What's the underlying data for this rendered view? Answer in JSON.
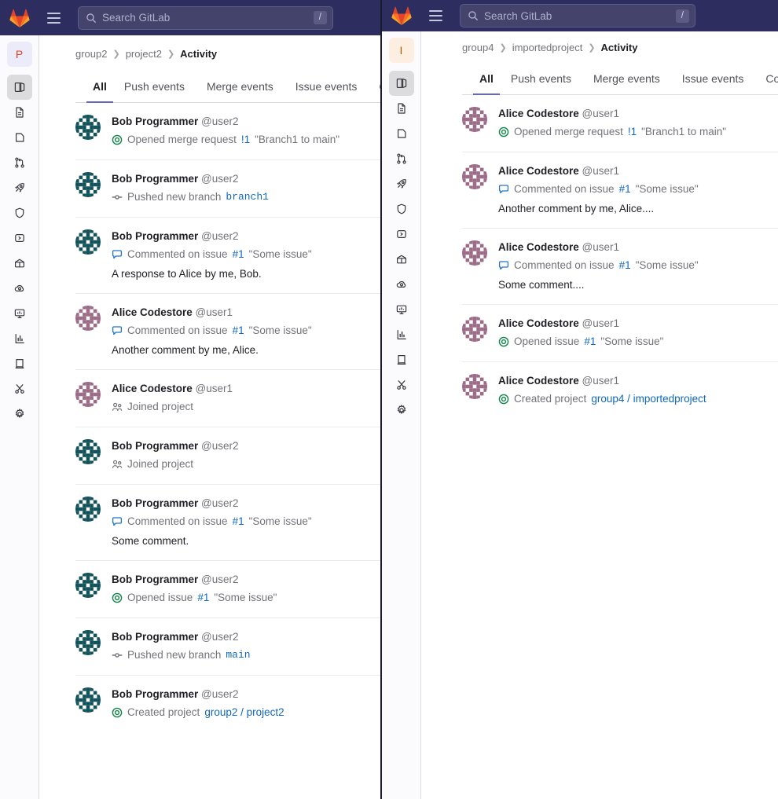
{
  "colors": {
    "header_bg": "#2d2d60",
    "accent": "#6666c4",
    "link": "#1068bf",
    "green": "#108548",
    "avatar_bob": "#12525a",
    "avatar_alice": "#9b6b87",
    "project_avatar_p_bg": "#ecebfa",
    "project_avatar_p_fg": "#e24329",
    "project_avatar_i_bg": "#fdeee2",
    "project_avatar_i_fg": "#ab6100"
  },
  "search": {
    "placeholder": "Search GitLab",
    "shortcut": "/"
  },
  "rail_icons": [
    {
      "name": "project-overview-icon",
      "active": true
    },
    {
      "name": "repository-file-icon",
      "active": false
    },
    {
      "name": "issues-icon",
      "active": false
    },
    {
      "name": "merge-requests-icon",
      "active": false
    },
    {
      "name": "pipelines-rocket-icon",
      "active": false
    },
    {
      "name": "security-shield-icon",
      "active": false
    },
    {
      "name": "deployments-icon",
      "active": false
    },
    {
      "name": "packages-box-icon",
      "active": false
    },
    {
      "name": "operations-cloud-gear-icon",
      "active": false
    },
    {
      "name": "monitor-icon",
      "active": false
    },
    {
      "name": "analytics-chart-icon",
      "active": false
    },
    {
      "name": "wiki-book-icon",
      "active": false
    },
    {
      "name": "snippets-scissors-icon",
      "active": false
    },
    {
      "name": "settings-gear-icon",
      "active": false
    }
  ],
  "tabs": [
    "All",
    "Push events",
    "Merge events",
    "Issue events",
    "Comments"
  ],
  "window_back": {
    "project_initial": "P",
    "breadcrumb": {
      "group": "group2",
      "project": "project2",
      "current": "Activity"
    },
    "active_tab": "All",
    "events": [
      {
        "user": "Bob Programmer",
        "handle": "@user2",
        "avatar": "bob",
        "icon": "issue-open-icon",
        "action": "Opened merge request",
        "ref": "!1",
        "ref_type": "link",
        "title": "\"Branch1 to main\"",
        "note": ""
      },
      {
        "user": "Bob Programmer",
        "handle": "@user2",
        "avatar": "bob",
        "icon": "commit-branch-icon",
        "action": "Pushed new branch",
        "ref": "branch1",
        "ref_type": "mono",
        "title": "",
        "note": ""
      },
      {
        "user": "Bob Programmer",
        "handle": "@user2",
        "avatar": "bob",
        "icon": "comment-icon",
        "action": "Commented on  issue",
        "ref": "#1",
        "ref_type": "link",
        "title": "\"Some issue\"",
        "note": "A response to Alice by me, Bob."
      },
      {
        "user": "Alice Codestore",
        "handle": "@user1",
        "avatar": "alice",
        "icon": "comment-icon",
        "action": "Commented on  issue",
        "ref": "#1",
        "ref_type": "link",
        "title": "\"Some issue\"",
        "note": "Another comment by me, Alice."
      },
      {
        "user": "Alice Codestore",
        "handle": "@user1",
        "avatar": "alice",
        "icon": "users-join-icon",
        "action": "Joined project",
        "ref": "",
        "ref_type": "none",
        "title": "",
        "note": ""
      },
      {
        "user": "Bob Programmer",
        "handle": "@user2",
        "avatar": "bob",
        "icon": "users-join-icon",
        "action": "Joined project",
        "ref": "",
        "ref_type": "none",
        "title": "",
        "note": ""
      },
      {
        "user": "Bob Programmer",
        "handle": "@user2",
        "avatar": "bob",
        "icon": "comment-icon",
        "action": "Commented on  issue",
        "ref": "#1",
        "ref_type": "link",
        "title": "\"Some issue\"",
        "note": "Some comment."
      },
      {
        "user": "Bob Programmer",
        "handle": "@user2",
        "avatar": "bob",
        "icon": "issue-open-icon",
        "action": "Opened issue",
        "ref": "#1",
        "ref_type": "link",
        "title": "\"Some issue\"",
        "note": ""
      },
      {
        "user": "Bob Programmer",
        "handle": "@user2",
        "avatar": "bob",
        "icon": "commit-branch-icon",
        "action": "Pushed new branch",
        "ref": "main",
        "ref_type": "mono",
        "title": "",
        "note": ""
      },
      {
        "user": "Bob Programmer",
        "handle": "@user2",
        "avatar": "bob",
        "icon": "issue-open-icon",
        "action": "Created project",
        "ref": "group2 / project2",
        "ref_type": "link",
        "title": "",
        "note": ""
      }
    ]
  },
  "window_front": {
    "project_initial": "I",
    "breadcrumb": {
      "group": "group4",
      "project": "importedproject",
      "current": "Activity"
    },
    "active_tab": "All",
    "events": [
      {
        "user": "Alice Codestore",
        "handle": "@user1",
        "avatar": "alice",
        "icon": "issue-open-icon",
        "action": "Opened merge request",
        "ref": "!1",
        "ref_type": "link",
        "title": "\"Branch1 to main\"",
        "note": ""
      },
      {
        "user": "Alice Codestore",
        "handle": "@user1",
        "avatar": "alice",
        "icon": "comment-icon",
        "action": "Commented on  issue",
        "ref": "#1",
        "ref_type": "link",
        "title": "\"Some issue\"",
        "note": "Another comment by me, Alice...."
      },
      {
        "user": "Alice Codestore",
        "handle": "@user1",
        "avatar": "alice",
        "icon": "comment-icon",
        "action": "Commented on  issue",
        "ref": "#1",
        "ref_type": "link",
        "title": "\"Some issue\"",
        "note": "Some comment...."
      },
      {
        "user": "Alice Codestore",
        "handle": "@user1",
        "avatar": "alice",
        "icon": "issue-open-icon",
        "action": "Opened issue",
        "ref": "#1",
        "ref_type": "link",
        "title": "\"Some issue\"",
        "note": ""
      },
      {
        "user": "Alice Codestore",
        "handle": "@user1",
        "avatar": "alice",
        "icon": "issue-open-icon",
        "action": "Created project",
        "ref": "group4 / importedproject",
        "ref_type": "link",
        "title": "",
        "note": ""
      }
    ]
  }
}
